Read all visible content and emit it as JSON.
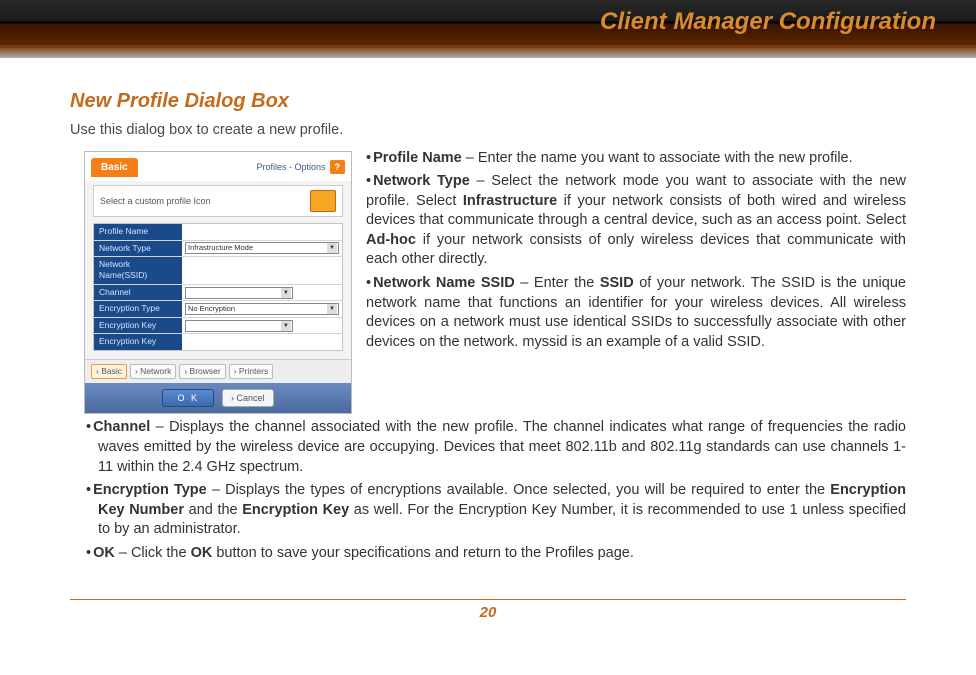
{
  "header": {
    "title": "Client Manager Configuration"
  },
  "section": {
    "title": "New Profile Dialog Box",
    "intro": "Use this dialog box to create a new profile."
  },
  "dialog": {
    "tab_basic": "Basic",
    "profiles_options": "Profiles - Options",
    "help": "?",
    "icon_row_text": "Select a custom profile Icon",
    "rows": {
      "profile_name": "Profile Name",
      "network_type": "Network Type",
      "network_type_val": "Infrastructure Mode",
      "network_name": "Network Name(SSID)",
      "channel": "Channel",
      "encryption_type": "Encryption Type",
      "encryption_type_val": "No Encryption",
      "encryption_key_no": "Encryption Key",
      "encryption_key": "Encryption Key"
    },
    "tabs": {
      "basic": "› Basic",
      "network": "› Network",
      "browser": "› Browser",
      "printers": "› Printers"
    },
    "ok": "O K",
    "cancel": "› Cancel"
  },
  "bullets": {
    "b1_label": "Profile Name",
    "b1_text": " – Enter the name you want to associate with the new profile.",
    "b2_label": "Network Type",
    "b2_a": " – Select the network mode you want to associate with the new profile. Select ",
    "b2_infra": "Infrastructure",
    "b2_b": " if your network consists of both wired and wireless devices that communicate through a central device, such as an access point. Select ",
    "b2_adhoc": "Ad-hoc",
    "b2_c": " if your network consists of only wireless devices that communicate with each other directly.",
    "b3_label": "Network Name SSID",
    "b3_a": " – Enter the ",
    "b3_ssid": "SSID",
    "b3_b": " of your network. The SSID is the unique network name that functions an identifier for your wireless devices. All wireless devices on a network must use identical SSIDs to successfully associate with other devices on the network. myssid is an example of a valid SSID.",
    "b4_label": "Channel",
    "b4_text": " – Displays the channel associated with the new profile. The channel indicates what range of frequencies the radio waves emitted by the wireless device are occupying. Devices that meet 802.11b and 802.11g standards can use channels 1-11 within the 2.4 GHz spectrum.",
    "b5_label": "Encryption Type",
    "b5_a": " –  Displays the types of encryptions available.  Once selected, you will be required to enter the ",
    "b5_ekn": "Encryption Key Number",
    "b5_b": " and the ",
    "b5_ek": "Encryption Key",
    "b5_c": " as well.  For the Encryption Key Number, it is recommended to use 1 unless specified to by an administrator.",
    "b6_label": "OK",
    "b6_a": " – Click the ",
    "b6_ok": "OK",
    "b6_b": " button to save your specifications and return to the Profiles page."
  },
  "page_number": "20"
}
